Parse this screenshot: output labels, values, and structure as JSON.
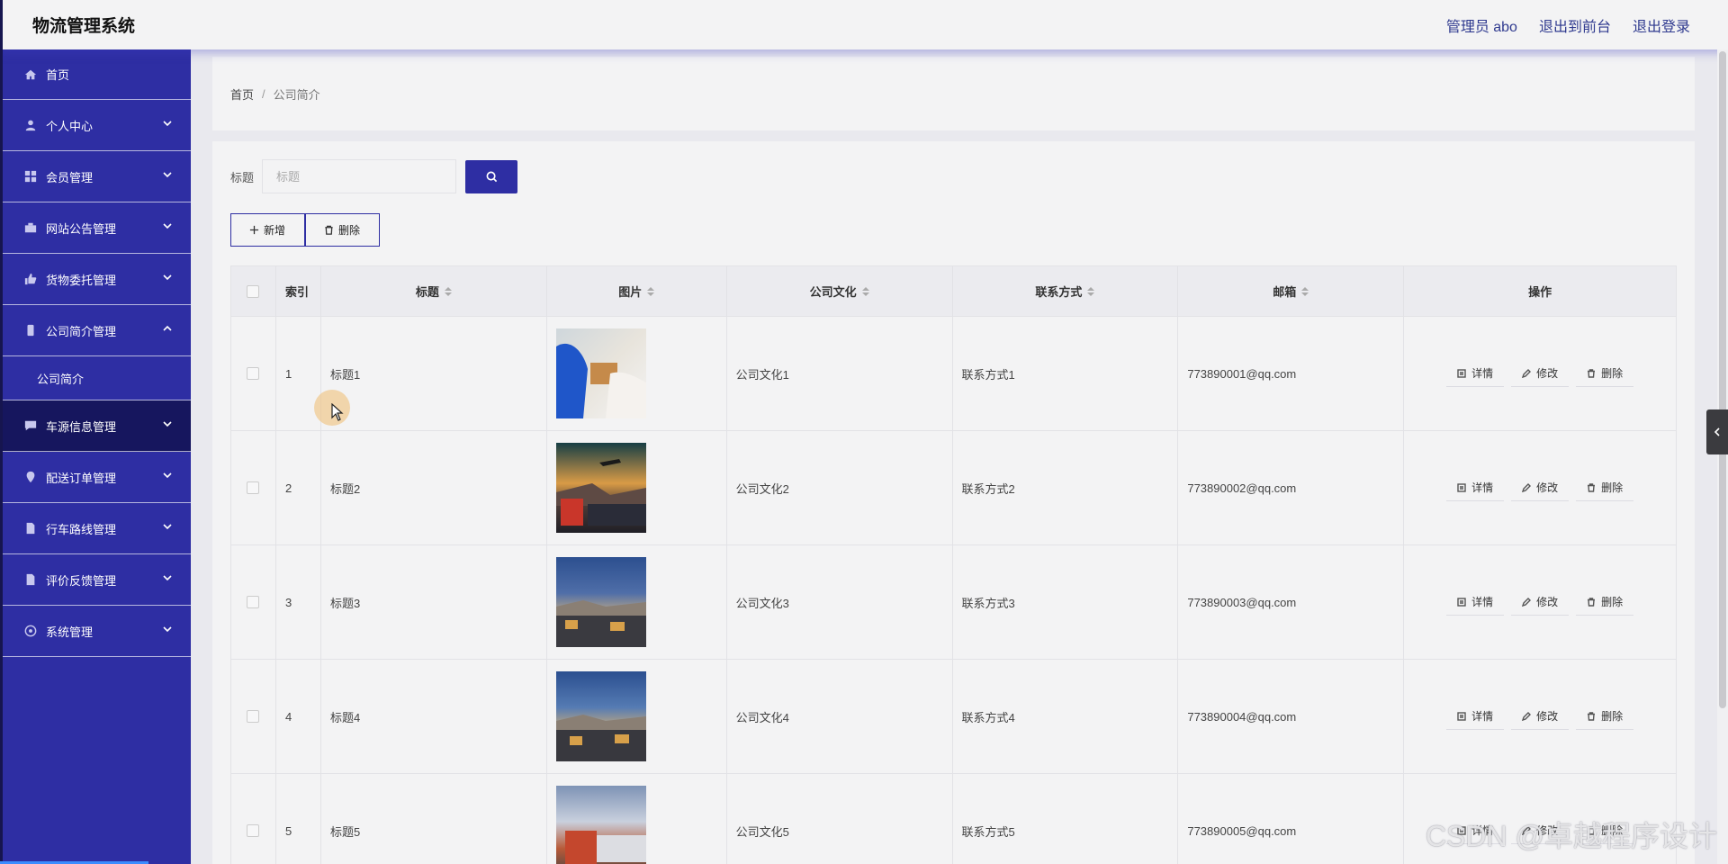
{
  "header": {
    "app_title": "物流管理系统",
    "admin_label": "管理员 abo",
    "back_to_front": "退出到前台",
    "logout": "退出登录"
  },
  "sidebar": {
    "items": [
      {
        "label": "首页",
        "icon": "home-icon"
      },
      {
        "label": "个人中心",
        "icon": "user-icon"
      },
      {
        "label": "会员管理",
        "icon": "grid-icon"
      },
      {
        "label": "网站公告管理",
        "icon": "briefcase-icon"
      },
      {
        "label": "货物委托管理",
        "icon": "thumb-icon"
      },
      {
        "label": "公司简介管理",
        "icon": "phone-icon",
        "expanded": true,
        "children": [
          {
            "label": "公司简介"
          }
        ]
      },
      {
        "label": "车源信息管理",
        "icon": "chat-icon"
      },
      {
        "label": "配送订单管理",
        "icon": "location-icon"
      },
      {
        "label": "行车路线管理",
        "icon": "doc-icon"
      },
      {
        "label": "评价反馈管理",
        "icon": "doc-icon"
      },
      {
        "label": "系统管理",
        "icon": "settings-icon"
      }
    ]
  },
  "breadcrumb": {
    "home": "首页",
    "separator": "/",
    "current": "公司简介"
  },
  "search": {
    "label": "标题",
    "placeholder": "标题"
  },
  "actions": {
    "add": "新增",
    "delete": "删除"
  },
  "table": {
    "headers": {
      "index": "索引",
      "title": "标题",
      "image": "图片",
      "culture": "公司文化",
      "contact": "联系方式",
      "email": "邮箱",
      "ops": "操作"
    },
    "op_labels": {
      "detail": "详情",
      "edit": "修改",
      "delete": "删除"
    },
    "rows": [
      {
        "index": "1",
        "title": "标题1",
        "culture": "公司文化1",
        "contact": "联系方式1",
        "email": "773890001@qq.com"
      },
      {
        "index": "2",
        "title": "标题2",
        "culture": "公司文化2",
        "contact": "联系方式2",
        "email": "773890002@qq.com"
      },
      {
        "index": "3",
        "title": "标题3",
        "culture": "公司文化3",
        "contact": "联系方式3",
        "email": "773890003@qq.com"
      },
      {
        "index": "4",
        "title": "标题4",
        "culture": "公司文化4",
        "contact": "联系方式4",
        "email": "773890004@qq.com"
      },
      {
        "index": "5",
        "title": "标题5",
        "culture": "公司文化5",
        "contact": "联系方式5",
        "email": "773890005@qq.com"
      }
    ]
  },
  "watermark": "CSDN @卓越程序设计",
  "colors": {
    "accent": "#2e2ea3",
    "sidebar_active": "#16165e",
    "link": "#2f3a8f"
  }
}
